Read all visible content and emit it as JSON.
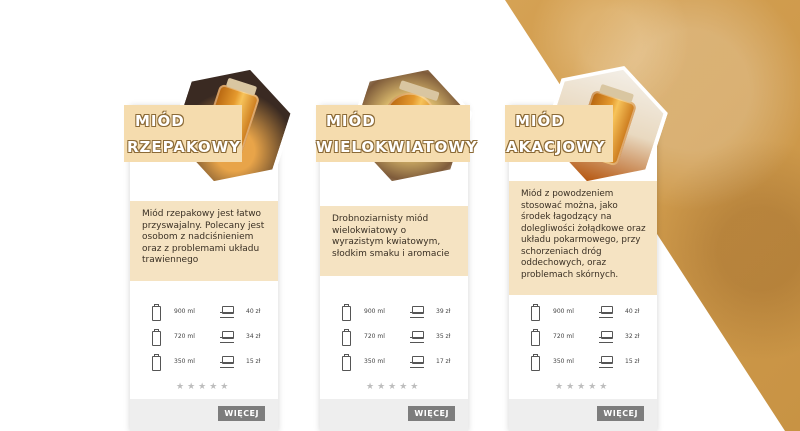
{
  "products": [
    {
      "title_line1": "MIÓD",
      "title_line2": "RZEPAKOWY",
      "description": "Miód rzepakowy jest łatwo przyswajalny. Polecany jest osobom z nadciśnieniem oraz z problemami układu trawiennego",
      "sizes": [
        {
          "volume": "900 ml",
          "price": "40 zł"
        },
        {
          "volume": "720 ml",
          "price": "34 zł"
        },
        {
          "volume": "350 ml",
          "price": "15 zł"
        }
      ],
      "rating": "★★★★★",
      "button": "WIĘCEJ",
      "image_icon": "honey-jar-image"
    },
    {
      "title_line1": "MIÓD",
      "title_line2": "WIELOKWIATOWY",
      "description": "Drobnoziarnisty miód wielokwiatowy o wyrazistym kwiatowym, słodkim smaku i aromacie",
      "sizes": [
        {
          "volume": "900 ml",
          "price": "39 zł"
        },
        {
          "volume": "720 ml",
          "price": "35 zł"
        },
        {
          "volume": "350 ml",
          "price": "17 zł"
        }
      ],
      "rating": "★★★★★",
      "button": "WIĘCEJ",
      "image_icon": "honey-jar-image"
    },
    {
      "title_line1": "MIÓD",
      "title_line2": "AKACJOWY",
      "description": "Miód z powodzeniem stosować można, jako środek łagodzący na dolegliwości żołądkowe oraz układu pokarmowego, przy schorzeniach dróg oddechowych, oraz problemach skórnych.",
      "sizes": [
        {
          "volume": "900 ml",
          "price": "40 zł"
        },
        {
          "volume": "720 ml",
          "price": "32 zł"
        },
        {
          "volume": "350 ml",
          "price": "15 zł"
        }
      ],
      "rating": "★★★★★",
      "button": "WIĘCEJ",
      "image_icon": "honey-jar-image"
    }
  ],
  "colors": {
    "accent": "#f5dcae",
    "description_bg": "#f5e3c2",
    "button_bg": "#7d7d7d",
    "background_photo": "#d4a052"
  }
}
